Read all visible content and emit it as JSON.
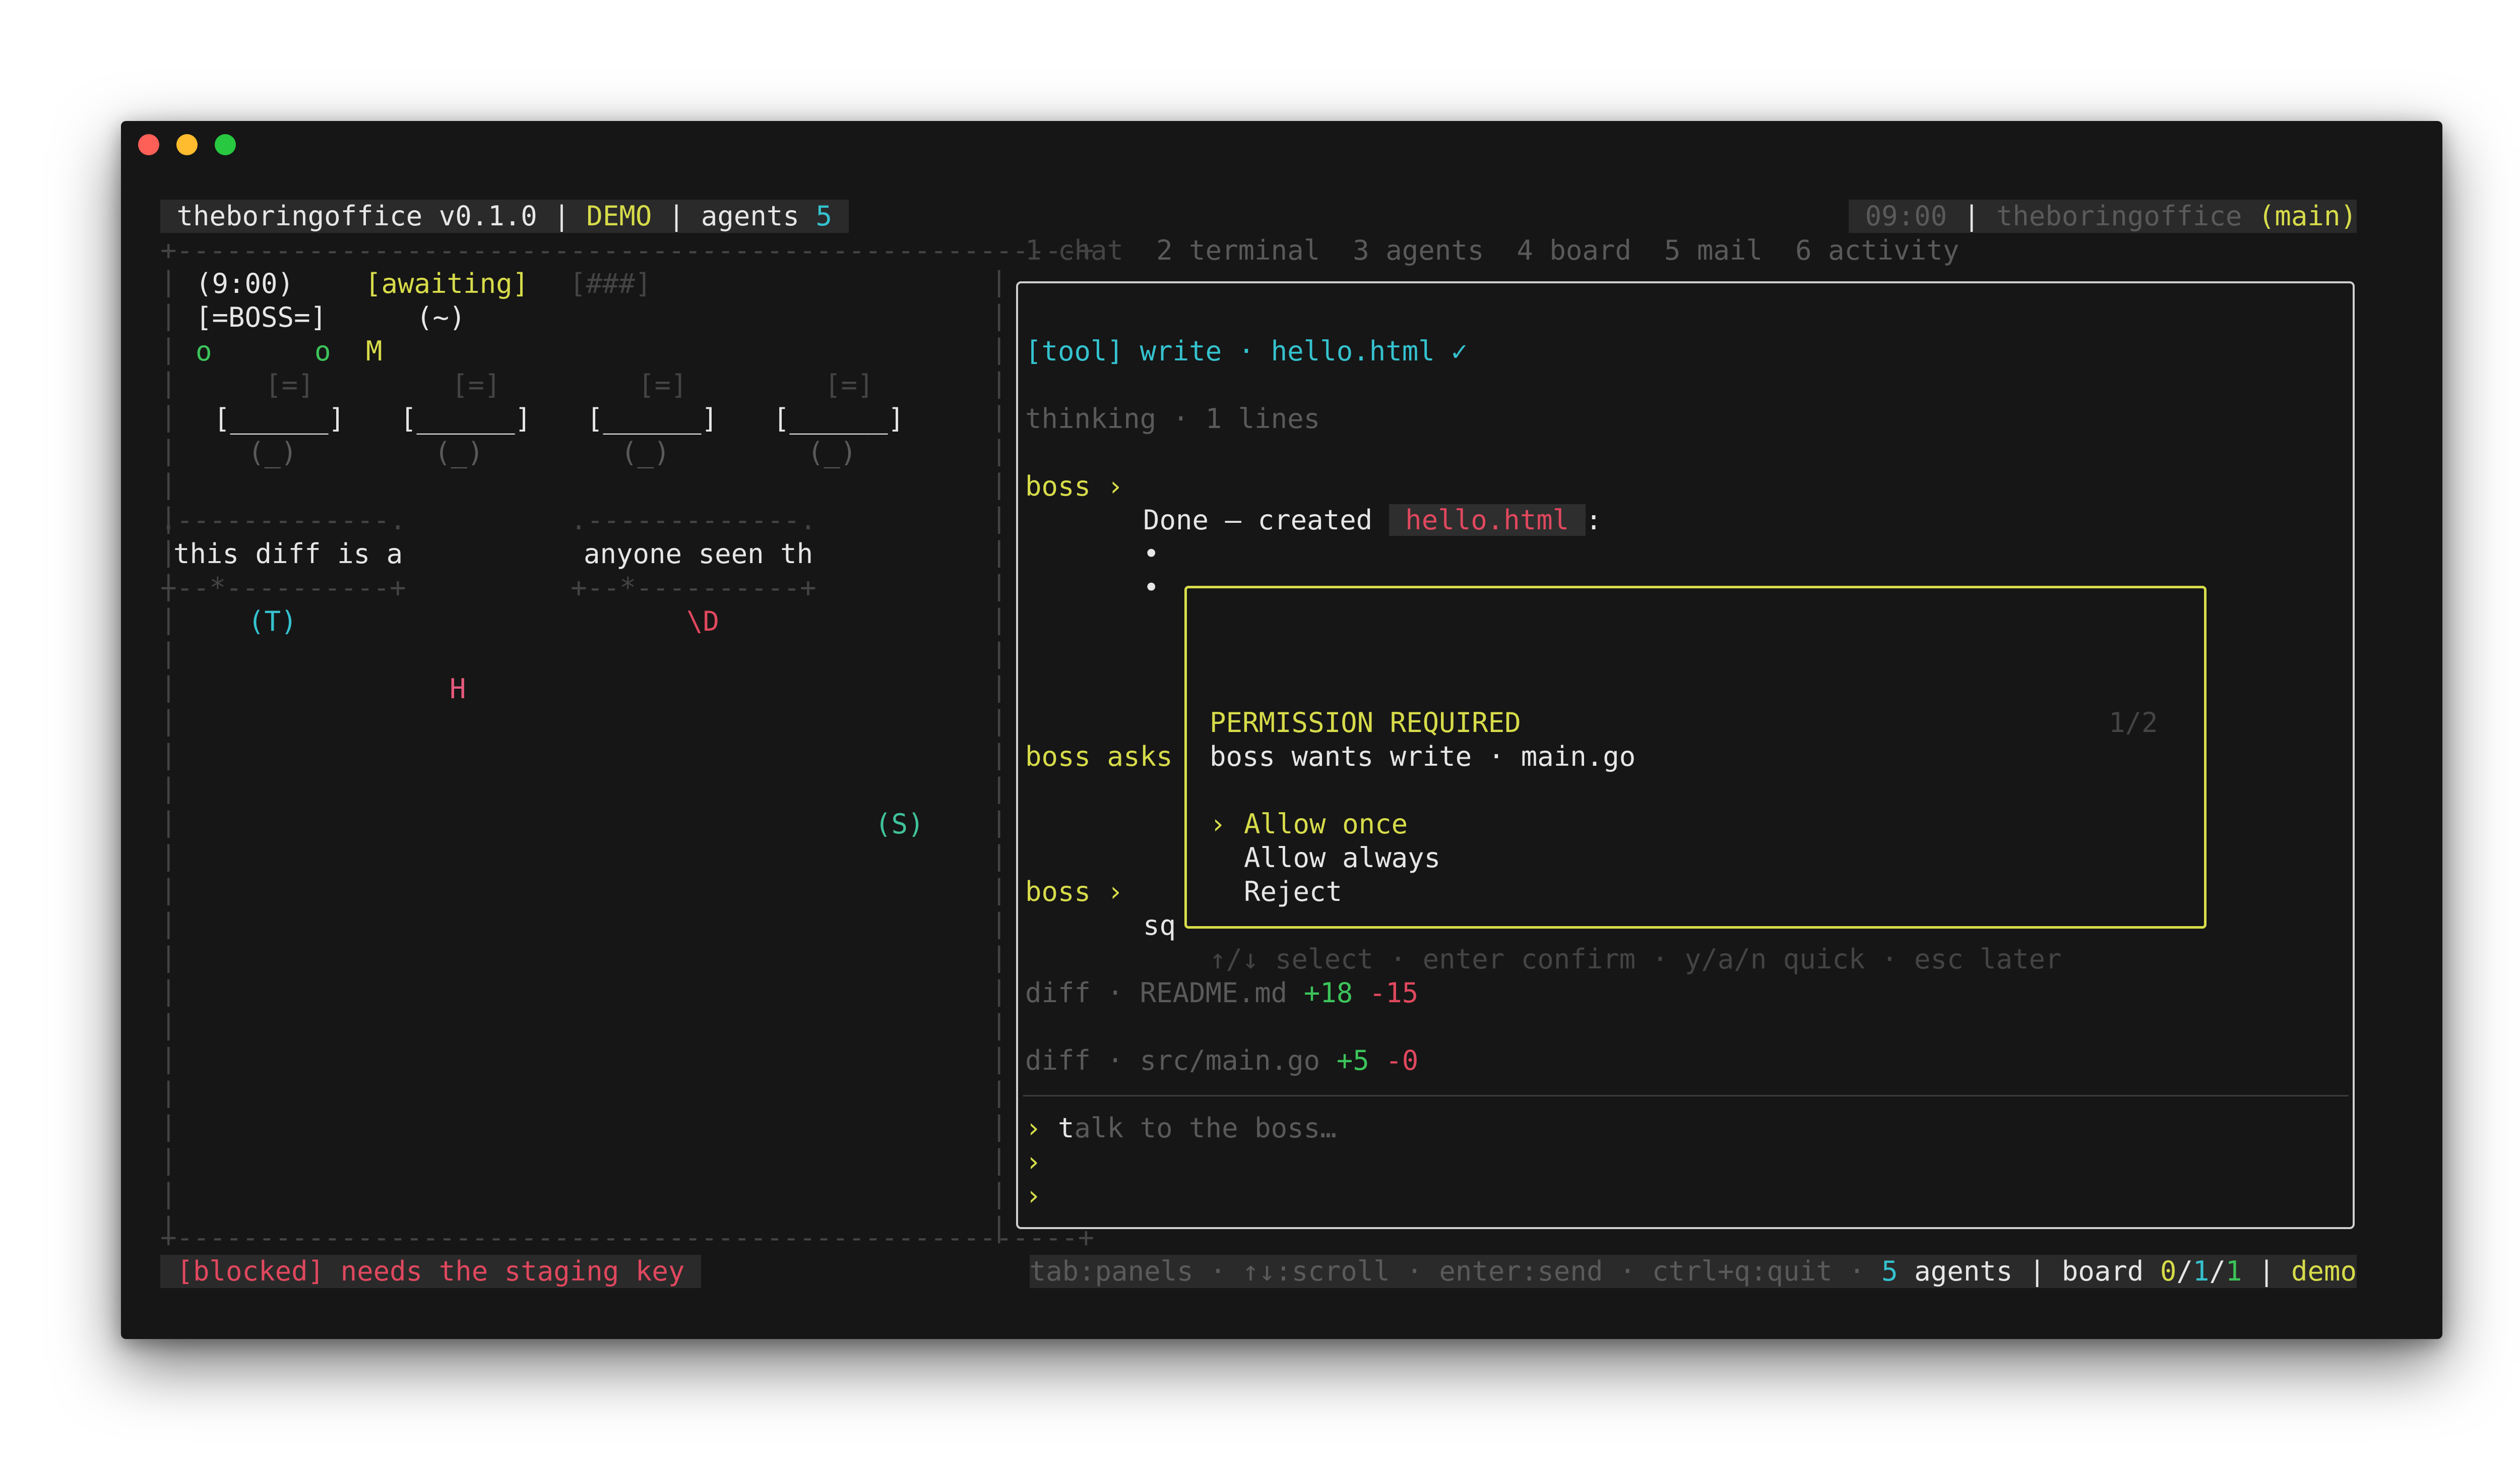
{
  "header": {
    "app_name": "theboringoffice v0.1.0",
    "sep1": " | ",
    "mode": "DEMO",
    "sep2": " | agents ",
    "agent_count": "5",
    "clock": "09:00",
    "sep3": " | ",
    "repo": "theboringoffice",
    "branch": "(main)"
  },
  "tabs": [
    {
      "label": "1 chat"
    },
    {
      "label": "2 terminal"
    },
    {
      "label": "3 agents"
    },
    {
      "label": "4 board"
    },
    {
      "label": "5 mail"
    },
    {
      "label": "6 activity"
    }
  ],
  "office": {
    "border_top": "+-------------------------------------------------------+",
    "border_bottom": "+-------------------------------------------------------+",
    "time": "(9:00)",
    "status": "[awaiting]",
    "progress": "[###]",
    "boss_desk": "[=BOSS=]",
    "boss_face": "(~)",
    "agents_row": [
      "o",
      "o",
      "M"
    ],
    "desk_monitor": "[=]",
    "desk_table": "[______]",
    "desk_chair": "(_)",
    "bubble1_top": ".-------------.",
    "bubble1_text": "this diff is a",
    "bubble1_bottom": "+--*----------+",
    "bubble2_top": ".-------------.",
    "bubble2_text": "anyone seen th",
    "bubble2_bottom": "+--*----------+",
    "agent_t": "(T)",
    "agent_d": "\\D",
    "agent_h": "H",
    "agent_s": "(S)"
  },
  "chat": {
    "tool_line": "[tool] write · hello.html ✓",
    "thinking": "thinking · 1 lines",
    "boss_label": "boss ›",
    "done_text": "Done — created ",
    "done_file": " hello.html ",
    "done_colon": ":",
    "bullet1": "•",
    "bullet2": "•",
    "boss_asks": "boss asks",
    "boss_label2": "boss ›",
    "sq": "sq",
    "diff1_prefix": "diff · README.md ",
    "diff1_add": "+18",
    "diff1_del": "-15",
    "diff2_prefix": "diff · src/main.go ",
    "diff2_add": "+5",
    "diff2_del": "-0",
    "input_prompt": "›",
    "input_cursor": "t",
    "input_placeholder": "alk to the boss…",
    "prompt2": "›",
    "prompt3": "›"
  },
  "permission": {
    "title": "PERMISSION REQUIRED",
    "counter": "1/2",
    "request": "boss wants write · main.go",
    "selector": "›",
    "options": [
      "Allow once",
      "Allow always",
      "Reject"
    ],
    "hint": "↑/↓ select · enter confirm · y/a/n quick · esc later"
  },
  "statusbar": {
    "blocked": "[blocked] needs the staging key",
    "keys": "tab:panels · ↑↓:scroll · enter:send · ctrl+q:quit · ",
    "agents_num": "5",
    "agents_word": " agents | board ",
    "board_a": "0",
    "board_sep1": "/",
    "board_b": "1",
    "board_sep2": "/",
    "board_c": "1",
    "sep": " | ",
    "mode": "demo"
  },
  "colors": {
    "accent_yellow": "#d7dc4a",
    "accent_cyan": "#35c2cf",
    "add_green": "#3cc45a",
    "del_red": "#e0485e",
    "background": "#161616"
  }
}
